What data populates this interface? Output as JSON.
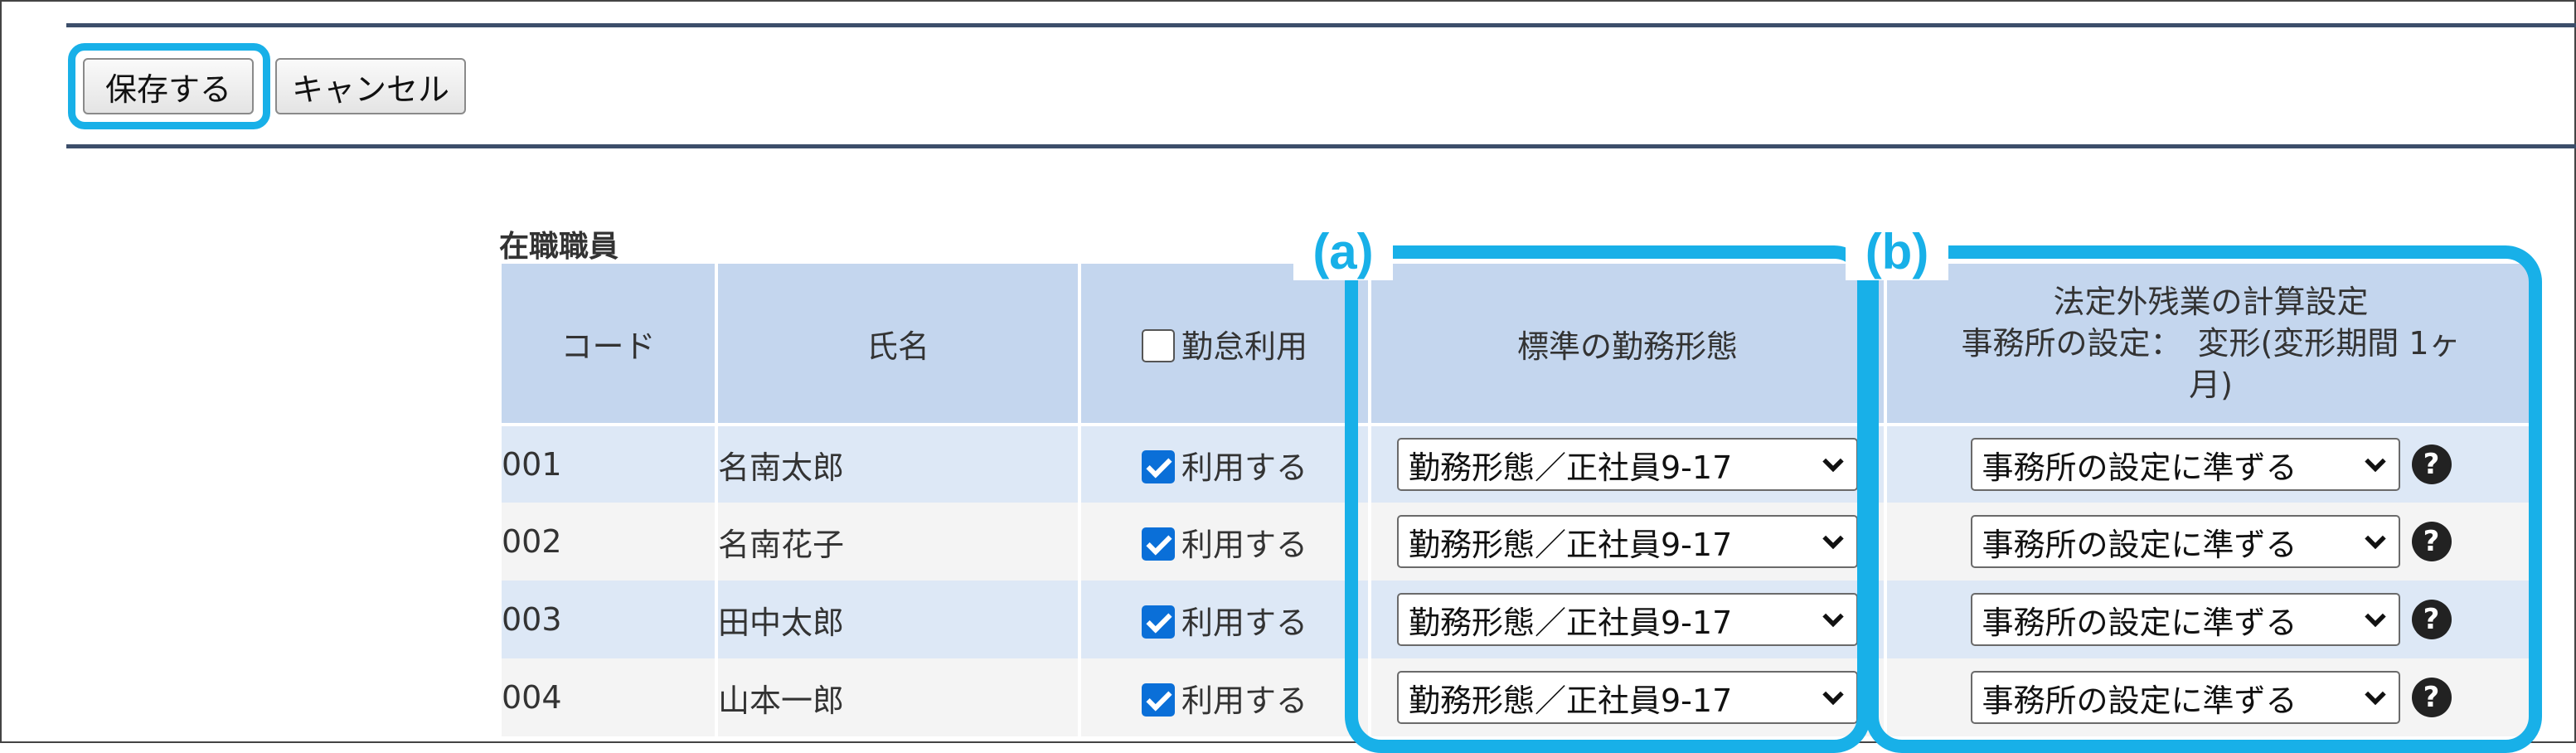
{
  "toolbar": {
    "save_label": "保存する",
    "cancel_label": "キャンセル"
  },
  "section": {
    "caption": "在職職員"
  },
  "table": {
    "headers": {
      "code": "コード",
      "name": "氏名",
      "attendance": "勤怠利用",
      "work_pattern": "標準の勤務形態",
      "overtime_line1": "法定外残業の計算設定",
      "overtime_line2": "事務所の設定：　変形(変形期間 1ヶ",
      "overtime_line3": "月)"
    },
    "rows": [
      {
        "code": "001",
        "name": "名南太郎",
        "attendance": "利用する",
        "attendance_checked": true,
        "work_pattern": "勤務形態／正社員9-17",
        "overtime": "事務所の設定に準ずる"
      },
      {
        "code": "002",
        "name": "名南花子",
        "attendance": "利用する",
        "attendance_checked": true,
        "work_pattern": "勤務形態／正社員9-17",
        "overtime": "事務所の設定に準ずる"
      },
      {
        "code": "003",
        "name": "田中太郎",
        "attendance": "利用する",
        "attendance_checked": true,
        "work_pattern": "勤務形態／正社員9-17",
        "overtime": "事務所の設定に準ずる"
      },
      {
        "code": "004",
        "name": "山本一郎",
        "attendance": "利用する",
        "attendance_checked": true,
        "work_pattern": "勤務形態／正社員9-17",
        "overtime": "事務所の設定に準ずる"
      }
    ]
  },
  "annotations": {
    "a": "(a)",
    "b": "(b)"
  },
  "icons": {
    "select_arrow": "chevron-down-icon",
    "help": "question-circle-icon",
    "checkbox": "checkbox-icon"
  },
  "colors": {
    "highlight": "#18b0e8",
    "header_bg": "#c4d6ee",
    "row_odd": "#dde8f6",
    "row_even": "#f4f4f4",
    "checkbox": "#0a6fd8"
  }
}
